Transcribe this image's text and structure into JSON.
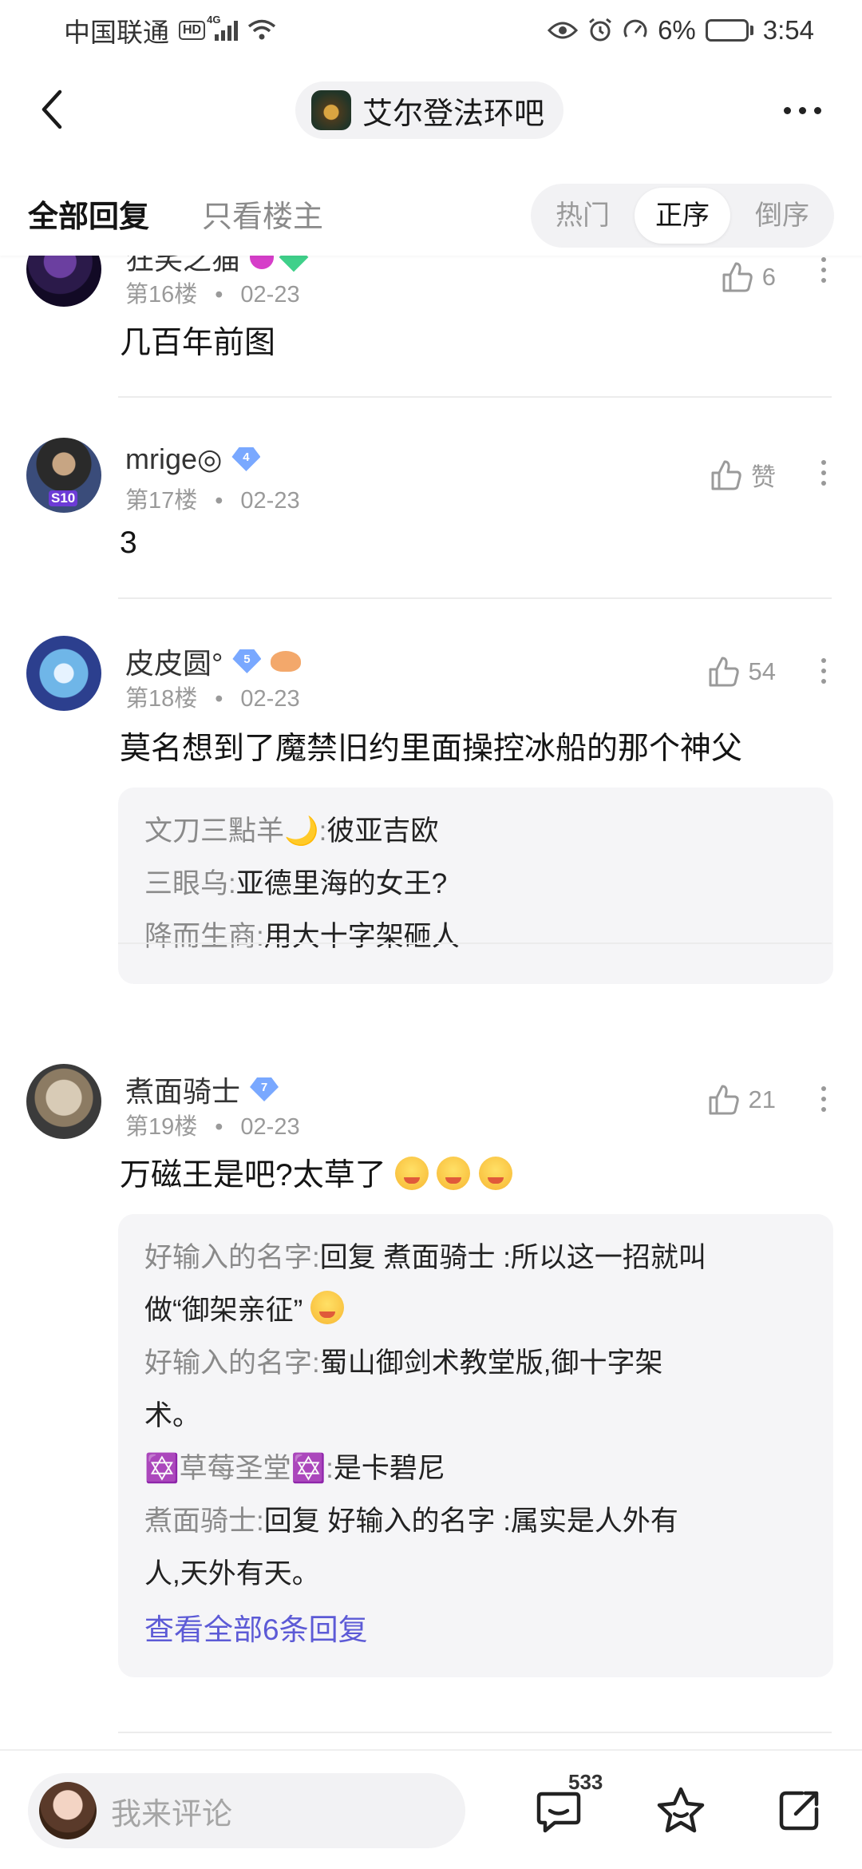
{
  "status_bar": {
    "carrier": "中国联通",
    "hd": "HD",
    "network": "4G",
    "battery": "6%",
    "time": "3:54"
  },
  "nav": {
    "forum_name": "艾尔登法环吧"
  },
  "tabs": {
    "all": "全部回复",
    "owner_only": "只看楼主",
    "sort": [
      "热门",
      "正序",
      "倒序"
    ],
    "active_sort": "正序"
  },
  "posts": [
    {
      "username": "狂笑之猫",
      "floor": "第16楼",
      "date": "02-23",
      "likes": "6",
      "text": "几百年前图"
    },
    {
      "username": "mrige◎",
      "level": "4",
      "floor": "第17楼",
      "date": "02-23",
      "likes": "赞",
      "text": "3",
      "avatar_badge": "S10"
    },
    {
      "username": "皮皮圆°",
      "level": "5",
      "floor": "第18楼",
      "date": "02-23",
      "likes": "54",
      "text": "莫名想到了魔禁旧约里面操控冰船的那个神父",
      "replies": [
        {
          "name": "文刀三點羊🌙",
          "text": "彼亚吉欧"
        },
        {
          "name": "三眼乌",
          "text": "亚德里海的女王?"
        },
        {
          "name": "降而生商",
          "text": "用大十字架砸人"
        }
      ]
    },
    {
      "username": "煮面骑士",
      "level": "7",
      "floor": "第19楼",
      "date": "02-23",
      "likes": "21",
      "text": "万磁王是吧?太草了",
      "replies": [
        {
          "name": "好输入的名字",
          "text_line1": "回复 煮面骑士 :所以这一招就叫",
          "text_line2": "做“御架亲征”"
        },
        {
          "name": "好输入的名字",
          "text_line1": "蜀山御剑术教堂版,御十字架",
          "text_line2": "术。"
        },
        {
          "name": "✡️草莓圣堂✡️",
          "text": "是卡碧尼"
        },
        {
          "name": "煮面骑士",
          "text_line1": "回复 好输入的名字 :属实是人外有",
          "text_line2": "人,天外有天。"
        }
      ],
      "view_all": "查看全部6条回复"
    }
  ],
  "bottom": {
    "comment_placeholder": "我来评论",
    "comment_count": "533"
  },
  "colors": {
    "link": "#5c5ad6",
    "level_badge": "#79a8ff",
    "battery_low": "#e53935"
  }
}
